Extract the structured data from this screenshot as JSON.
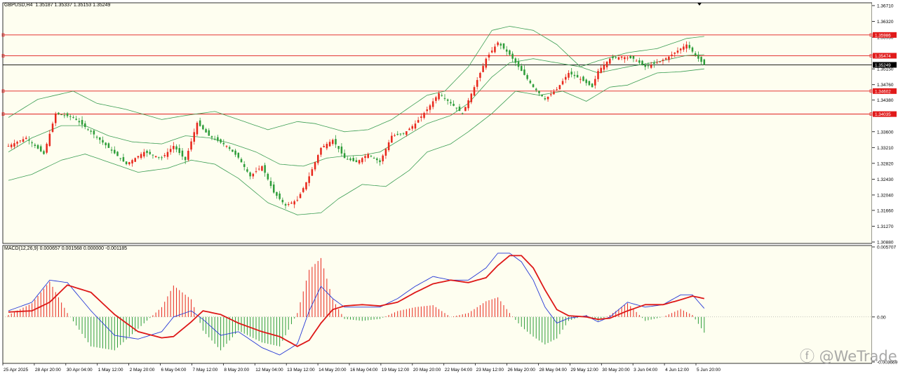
{
  "header": {
    "symbol": "GBPUSD,H4",
    "ohlc": "1.35187 1.35337 1.35153 1.35249"
  },
  "macd_header": {
    "label": "MACD(12,26,9) 0.000657 0.001568 0.000000 -0.001185"
  },
  "watermark": "ⓕ @WeTrade",
  "colors": {
    "background": "#fefef0",
    "bull": "#e8271c",
    "bear": "#2e9d3a",
    "band": "#3c9e54",
    "level_line": "#e11a1a",
    "price_line": "#000000",
    "macd_line": "#2638d6",
    "signal_line": "#dd1717",
    "hist_pos": "#e8271c",
    "hist_neg": "#2e9d3a"
  },
  "chart_data": [
    {
      "type": "candlestick",
      "title": "GBPUSD,H4",
      "yticks": [
        "1.36710",
        "1.36320",
        "1.35930",
        "1.35150",
        "1.34760",
        "1.34380",
        "1.33600",
        "1.33210",
        "1.32820",
        "1.32430",
        "1.32040",
        "1.31660",
        "1.31270",
        "1.30880"
      ],
      "ylim": [
        1.3088,
        1.3671
      ],
      "levels": [
        {
          "value": 1.35986,
          "label": "1.35986"
        },
        {
          "value": 1.35474,
          "label": "1.35474"
        },
        {
          "value": 1.34602,
          "label": "1.34602"
        },
        {
          "value": 1.34035,
          "label": "1.34035"
        }
      ],
      "current_price": {
        "value": 1.35249,
        "label": "1.35249"
      },
      "xticks": [
        "25 Apr 2025",
        "28 Apr 20:00",
        "30 Apr 04:00",
        "1 May 12:00",
        "2 May 20:00",
        "6 May 04:00",
        "7 May 12:00",
        "8 May 20:00",
        "12 May 04:00",
        "13 May 12:00",
        "14 May 20:00",
        "16 May 04:00",
        "19 May 12:00",
        "20 May 20:00",
        "22 May 04:00",
        "23 May 12:00",
        "26 May 20:00",
        "28 May 04:00",
        "29 May 12:00",
        "30 May 20:00",
        "3 Jun 04:00",
        "4 Jun 12:00",
        "5 Jun 20:00"
      ],
      "close_path": [
        [
          0,
          1.3325
        ],
        [
          6,
          1.3345
        ],
        [
          12,
          1.3305
        ],
        [
          16,
          1.3405
        ],
        [
          22,
          1.3395
        ],
        [
          28,
          1.336
        ],
        [
          34,
          1.332
        ],
        [
          40,
          1.328
        ],
        [
          46,
          1.331
        ],
        [
          52,
          1.3295
        ],
        [
          56,
          1.3325
        ],
        [
          60,
          1.329
        ],
        [
          64,
          1.3382
        ],
        [
          68,
          1.335
        ],
        [
          74,
          1.3325
        ],
        [
          78,
          1.3296
        ],
        [
          82,
          1.325
        ],
        [
          86,
          1.3275
        ],
        [
          90,
          1.321
        ],
        [
          94,
          1.3178
        ],
        [
          98,
          1.3192
        ],
        [
          102,
          1.325
        ],
        [
          106,
          1.332
        ],
        [
          110,
          1.334
        ],
        [
          114,
          1.3295
        ],
        [
          118,
          1.3285
        ],
        [
          122,
          1.3305
        ],
        [
          126,
          1.3285
        ],
        [
          130,
          1.335
        ],
        [
          134,
          1.3355
        ],
        [
          138,
          1.338
        ],
        [
          142,
          1.3415
        ],
        [
          146,
          1.3455
        ],
        [
          150,
          1.343
        ],
        [
          154,
          1.3405
        ],
        [
          158,
          1.347
        ],
        [
          162,
          1.354
        ],
        [
          166,
          1.358
        ],
        [
          170,
          1.355
        ],
        [
          174,
          1.351
        ],
        [
          178,
          1.347
        ],
        [
          182,
          1.344
        ],
        [
          186,
          1.3465
        ],
        [
          190,
          1.3505
        ],
        [
          194,
          1.349
        ],
        [
          198,
          1.347
        ],
        [
          200,
          1.351
        ],
        [
          204,
          1.354
        ],
        [
          208,
          1.3545
        ],
        [
          212,
          1.354
        ],
        [
          216,
          1.352
        ],
        [
          220,
          1.353
        ],
        [
          224,
          1.3545
        ],
        [
          228,
          1.3565
        ],
        [
          230,
          1.3575
        ],
        [
          234,
          1.354
        ],
        [
          236,
          1.3525
        ]
      ],
      "upper_band_path": [
        [
          0,
          1.3395
        ],
        [
          10,
          1.344
        ],
        [
          22,
          1.346
        ],
        [
          30,
          1.343
        ],
        [
          40,
          1.3415
        ],
        [
          52,
          1.339
        ],
        [
          60,
          1.34
        ],
        [
          70,
          1.341
        ],
        [
          80,
          1.3385
        ],
        [
          88,
          1.3365
        ],
        [
          98,
          1.3385
        ],
        [
          104,
          1.338
        ],
        [
          114,
          1.336
        ],
        [
          122,
          1.3365
        ],
        [
          130,
          1.339
        ],
        [
          136,
          1.342
        ],
        [
          142,
          1.345
        ],
        [
          148,
          1.346
        ],
        [
          156,
          1.352
        ],
        [
          164,
          1.361
        ],
        [
          170,
          1.362
        ],
        [
          178,
          1.361
        ],
        [
          186,
          1.3575
        ],
        [
          194,
          1.352
        ],
        [
          200,
          1.3535
        ],
        [
          210,
          1.3555
        ],
        [
          220,
          1.3565
        ],
        [
          230,
          1.359
        ],
        [
          236,
          1.3595
        ]
      ],
      "middle_band_path": [
        [
          0,
          1.331
        ],
        [
          8,
          1.3345
        ],
        [
          18,
          1.3375
        ],
        [
          26,
          1.3375
        ],
        [
          34,
          1.335
        ],
        [
          42,
          1.3335
        ],
        [
          52,
          1.333
        ],
        [
          60,
          1.335
        ],
        [
          68,
          1.3345
        ],
        [
          76,
          1.333
        ],
        [
          84,
          1.331
        ],
        [
          92,
          1.328
        ],
        [
          100,
          1.3275
        ],
        [
          108,
          1.3295
        ],
        [
          114,
          1.33
        ],
        [
          120,
          1.3302
        ],
        [
          126,
          1.331
        ],
        [
          134,
          1.3345
        ],
        [
          142,
          1.338
        ],
        [
          150,
          1.34
        ],
        [
          156,
          1.343
        ],
        [
          164,
          1.3495
        ],
        [
          170,
          1.353
        ],
        [
          178,
          1.354
        ],
        [
          186,
          1.353
        ],
        [
          194,
          1.352
        ],
        [
          200,
          1.3505
        ],
        [
          210,
          1.352
        ],
        [
          220,
          1.3532
        ],
        [
          230,
          1.3548
        ],
        [
          236,
          1.355
        ]
      ],
      "lower_band_path": [
        [
          0,
          1.324
        ],
        [
          8,
          1.3255
        ],
        [
          18,
          1.329
        ],
        [
          26,
          1.3305
        ],
        [
          34,
          1.3285
        ],
        [
          44,
          1.326
        ],
        [
          54,
          1.327
        ],
        [
          62,
          1.329
        ],
        [
          70,
          1.328
        ],
        [
          78,
          1.3245
        ],
        [
          88,
          1.3185
        ],
        [
          98,
          1.3155
        ],
        [
          106,
          1.316
        ],
        [
          112,
          1.3195
        ],
        [
          120,
          1.323
        ],
        [
          128,
          1.3225
        ],
        [
          136,
          1.3265
        ],
        [
          142,
          1.331
        ],
        [
          150,
          1.333
        ],
        [
          156,
          1.336
        ],
        [
          164,
          1.3405
        ],
        [
          172,
          1.346
        ],
        [
          180,
          1.345
        ],
        [
          188,
          1.346
        ],
        [
          196,
          1.3435
        ],
        [
          204,
          1.347
        ],
        [
          210,
          1.3475
        ],
        [
          220,
          1.3505
        ],
        [
          228,
          1.3508
        ],
        [
          236,
          1.3515
        ]
      ]
    },
    {
      "type": "macd",
      "title": "MACD(12,26,9)",
      "yticks": [
        "0.005707",
        "0.00",
        "-0.003669"
      ],
      "ylim": [
        -0.003669,
        0.005707
      ],
      "macd_path": [
        [
          0,
          0.0005
        ],
        [
          8,
          0.0012
        ],
        [
          14,
          0.003
        ],
        [
          20,
          0.0028
        ],
        [
          28,
          0.0005
        ],
        [
          36,
          -0.0015
        ],
        [
          44,
          -0.0018
        ],
        [
          52,
          -0.0012
        ],
        [
          56,
          0.0
        ],
        [
          62,
          0.0005
        ],
        [
          66,
          -0.0002
        ],
        [
          72,
          -0.0015
        ],
        [
          78,
          -0.0012
        ],
        [
          86,
          -0.0025
        ],
        [
          92,
          -0.0031
        ],
        [
          98,
          -0.0022
        ],
        [
          102,
          0.0005
        ],
        [
          106,
          0.0025
        ],
        [
          110,
          0.0015
        ],
        [
          114,
          0.0008
        ],
        [
          120,
          0.0008
        ],
        [
          126,
          0.0008
        ],
        [
          132,
          0.0015
        ],
        [
          138,
          0.0025
        ],
        [
          144,
          0.0033
        ],
        [
          150,
          0.003
        ],
        [
          156,
          0.003
        ],
        [
          162,
          0.004
        ],
        [
          166,
          0.0052
        ],
        [
          170,
          0.0052
        ],
        [
          174,
          0.0045
        ],
        [
          178,
          0.003
        ],
        [
          182,
          0.0008
        ],
        [
          186,
          -0.0005
        ],
        [
          190,
          -0.0001
        ],
        [
          196,
          0.0001
        ],
        [
          200,
          -0.0004
        ],
        [
          204,
          0.0
        ],
        [
          210,
          0.0012
        ],
        [
          216,
          0.0008
        ],
        [
          222,
          0.001
        ],
        [
          228,
          0.0018
        ],
        [
          232,
          0.0018
        ],
        [
          236,
          0.0007
        ]
      ],
      "signal_path": [
        [
          0,
          0.0004
        ],
        [
          8,
          0.0005
        ],
        [
          14,
          0.0012
        ],
        [
          20,
          0.0026
        ],
        [
          28,
          0.002
        ],
        [
          36,
          0.0002
        ],
        [
          44,
          -0.0012
        ],
        [
          52,
          -0.0017
        ],
        [
          56,
          -0.0016
        ],
        [
          62,
          -0.0004
        ],
        [
          66,
          0.0005
        ],
        [
          72,
          0.0002
        ],
        [
          78,
          -0.0005
        ],
        [
          86,
          -0.0012
        ],
        [
          92,
          -0.0016
        ],
        [
          98,
          -0.0024
        ],
        [
          102,
          -0.0019
        ],
        [
          106,
          -0.0005
        ],
        [
          110,
          0.0006
        ],
        [
          114,
          0.0009
        ],
        [
          120,
          0.001
        ],
        [
          126,
          0.0009
        ],
        [
          132,
          0.0012
        ],
        [
          138,
          0.002
        ],
        [
          144,
          0.0027
        ],
        [
          150,
          0.003
        ],
        [
          156,
          0.0028
        ],
        [
          162,
          0.0032
        ],
        [
          166,
          0.0042
        ],
        [
          170,
          0.005
        ],
        [
          174,
          0.005
        ],
        [
          178,
          0.004
        ],
        [
          182,
          0.0022
        ],
        [
          186,
          0.0006
        ],
        [
          190,
          0.0001
        ],
        [
          196,
          0.0
        ],
        [
          200,
          -0.0002
        ],
        [
          204,
          -0.0001
        ],
        [
          210,
          0.0005
        ],
        [
          216,
          0.001
        ],
        [
          222,
          0.001
        ],
        [
          228,
          0.0014
        ],
        [
          232,
          0.0017
        ],
        [
          236,
          0.0015
        ]
      ]
    }
  ]
}
